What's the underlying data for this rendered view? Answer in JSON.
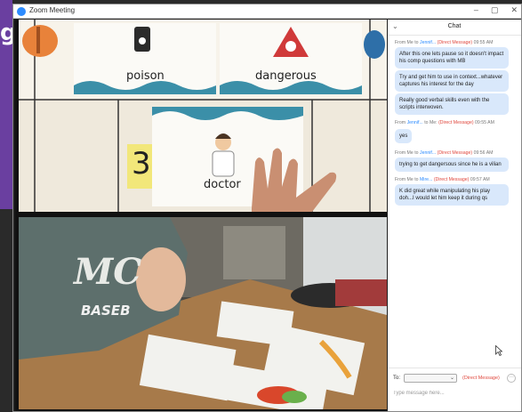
{
  "window": {
    "title": "Zoom Meeting"
  },
  "background": {
    "letter": "g"
  },
  "colors": {
    "accent": "#2d8cff",
    "direct_message": "#e0483e",
    "bubble": "#d9e8fb",
    "purple": "#6a3fa0"
  },
  "video_top": {
    "cards": [
      {
        "label": "poison"
      },
      {
        "label": "dangerous"
      },
      {
        "label": "doctor"
      }
    ],
    "number_card": "3"
  },
  "video_bottom": {
    "shirt_text": "MC",
    "shirt_word": "BASEB"
  },
  "chat": {
    "title": "Chat",
    "messages": [
      {
        "from": "From Me to",
        "to": "Jennif...",
        "tag": "(Direct Message)",
        "time": "09:55 AM",
        "bubbles": [
          "After this one lets pause so it doesn't impact his comp questions with MB",
          "Try and get him to use in context...whatever captures his interest for the day",
          "Really good verbal skills even with the scripts interwoven."
        ]
      },
      {
        "from": "From",
        "to": "Jennif...",
        "mid": "to Me:",
        "tag": "(Direct Message)",
        "time": "09:55 AM",
        "bubbles": [
          "yes"
        ]
      },
      {
        "from": "From Me to",
        "to": "Jennif...",
        "tag": "(Direct Message)",
        "time": "09:56 AM",
        "bubbles": [
          "trying to get dangersous since he is a vilian"
        ]
      },
      {
        "from": "From Me to",
        "to": "Mire...",
        "tag": "(Direct Message)",
        "time": "09:57 AM",
        "bubbles": [
          "K did great while manipulating his play doh...I would let him keep it during qs"
        ]
      }
    ],
    "footer": {
      "to_label": "To:",
      "dm_tag": "(Direct Message)",
      "more": "···",
      "placeholder": "Type message here..."
    }
  },
  "icons": {
    "logo": "zoom-logo-icon",
    "minimize": "minimize-icon",
    "maximize": "maximize-icon",
    "close": "close-icon",
    "chevron": "chevron-down-icon",
    "cursor": "mouse-cursor-icon"
  },
  "window_controls": {
    "minimize": "–",
    "maximize": "▢",
    "close": "✕"
  },
  "chat_chevron": "⌄"
}
